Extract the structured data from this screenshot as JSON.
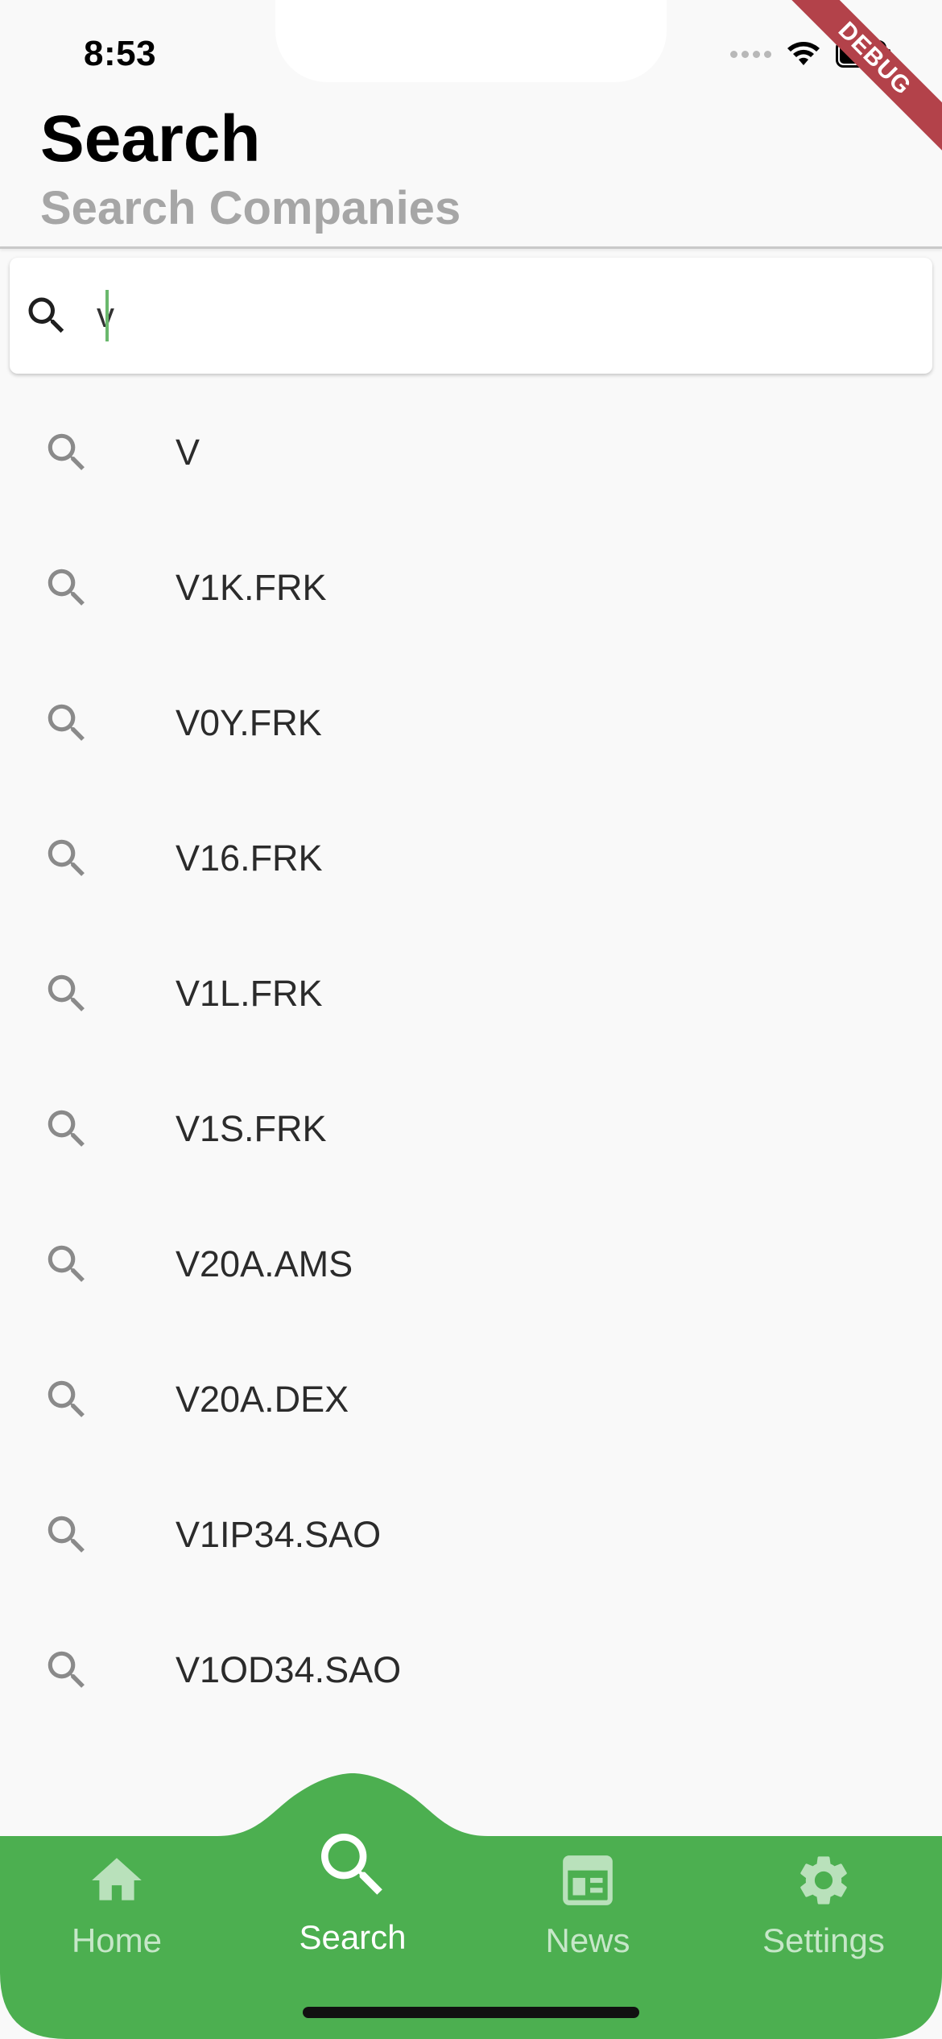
{
  "status_bar": {
    "time": "8:53"
  },
  "debug_banner": "DEBUG",
  "header": {
    "title": "Search",
    "subtitle": "Search Companies"
  },
  "search": {
    "value": "v",
    "icon": "search-icon"
  },
  "results": [
    {
      "label": "V",
      "icon": "search-icon"
    },
    {
      "label": "V1K.FRK",
      "icon": "search-icon"
    },
    {
      "label": "V0Y.FRK",
      "icon": "search-icon"
    },
    {
      "label": "V16.FRK",
      "icon": "search-icon"
    },
    {
      "label": "V1L.FRK",
      "icon": "search-icon"
    },
    {
      "label": "V1S.FRK",
      "icon": "search-icon"
    },
    {
      "label": "V20A.AMS",
      "icon": "search-icon"
    },
    {
      "label": "V20A.DEX",
      "icon": "search-icon"
    },
    {
      "label": "V1IP34.SAO",
      "icon": "search-icon"
    },
    {
      "label": "V1OD34.SAO",
      "icon": "search-icon"
    }
  ],
  "bottom_nav": {
    "items": [
      {
        "label": "Home",
        "icon": "home-icon",
        "active": false
      },
      {
        "label": "Search",
        "icon": "search-icon",
        "active": true
      },
      {
        "label": "News",
        "icon": "newspaper-icon",
        "active": false
      },
      {
        "label": "Settings",
        "icon": "gear-icon",
        "active": false
      }
    ]
  },
  "colors": {
    "accent_green": "#4caf50",
    "caret": "#6ab86d",
    "debug_red": "#b3424a",
    "subtitle_gray": "#a6a6a6",
    "background": "#f9f9f9"
  }
}
